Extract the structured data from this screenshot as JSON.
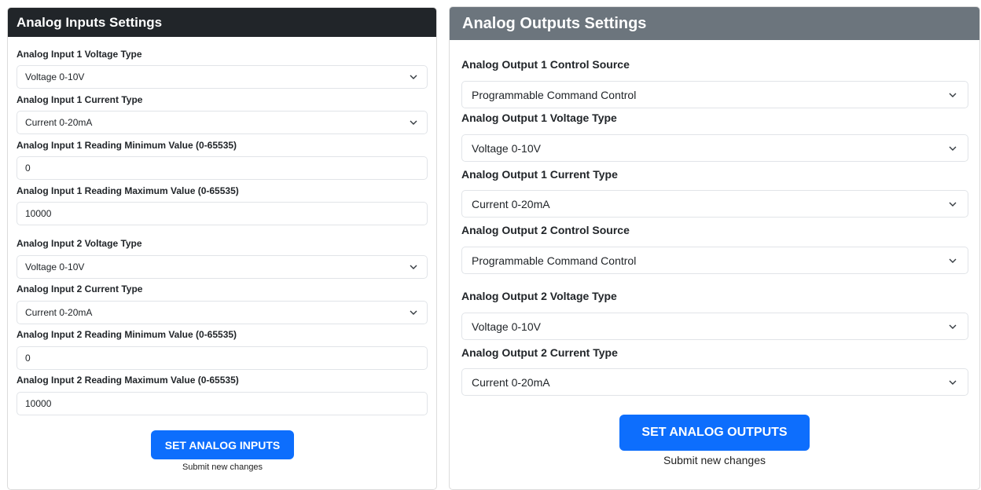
{
  "inputs": {
    "title": "Analog Inputs Settings",
    "fields": [
      {
        "label": "Analog Input 1 Voltage Type",
        "value": "Voltage 0-10V"
      },
      {
        "label": "Analog Input 1 Current Type",
        "value": "Current 0-20mA"
      },
      {
        "label": "Analog Input 1 Reading Minimum Value (0-65535)",
        "value": "0"
      },
      {
        "label": "Analog Input 1 Reading Maximum Value (0-65535)",
        "value": "10000"
      },
      {
        "label": "Analog Input 2 Voltage Type",
        "value": "Voltage 0-10V"
      },
      {
        "label": "Analog Input 2 Current Type",
        "value": "Current 0-20mA"
      },
      {
        "label": "Analog Input 2 Reading Minimum Value (0-65535)",
        "value": "0"
      },
      {
        "label": "Analog Input 2 Reading Maximum Value (0-65535)",
        "value": "10000"
      }
    ],
    "button_label": "SET ANALOG INPUTS",
    "submit_text": "Submit new changes"
  },
  "outputs": {
    "title": "Analog Outputs Settings",
    "fields": [
      {
        "label": "Analog Output 1 Control Source",
        "value": "Programmable Command Control"
      },
      {
        "label": "Analog Output 1 Voltage Type",
        "value": "Voltage 0-10V"
      },
      {
        "label": "Analog Output 1 Current Type",
        "value": "Current 0-20mA"
      },
      {
        "label": "Analog Output 2 Control Source",
        "value": "Programmable Command Control"
      },
      {
        "label": "Analog Output 2 Voltage Type",
        "value": "Voltage 0-10V"
      },
      {
        "label": "Analog Output 2 Current Type",
        "value": "Current 0-20mA"
      }
    ],
    "button_label": "SET ANALOG OUTPUTS",
    "submit_text": "Submit new changes"
  },
  "colors": {
    "inputs_header": "#212529",
    "outputs_header": "#6c757d",
    "button": "#0d6efd"
  }
}
